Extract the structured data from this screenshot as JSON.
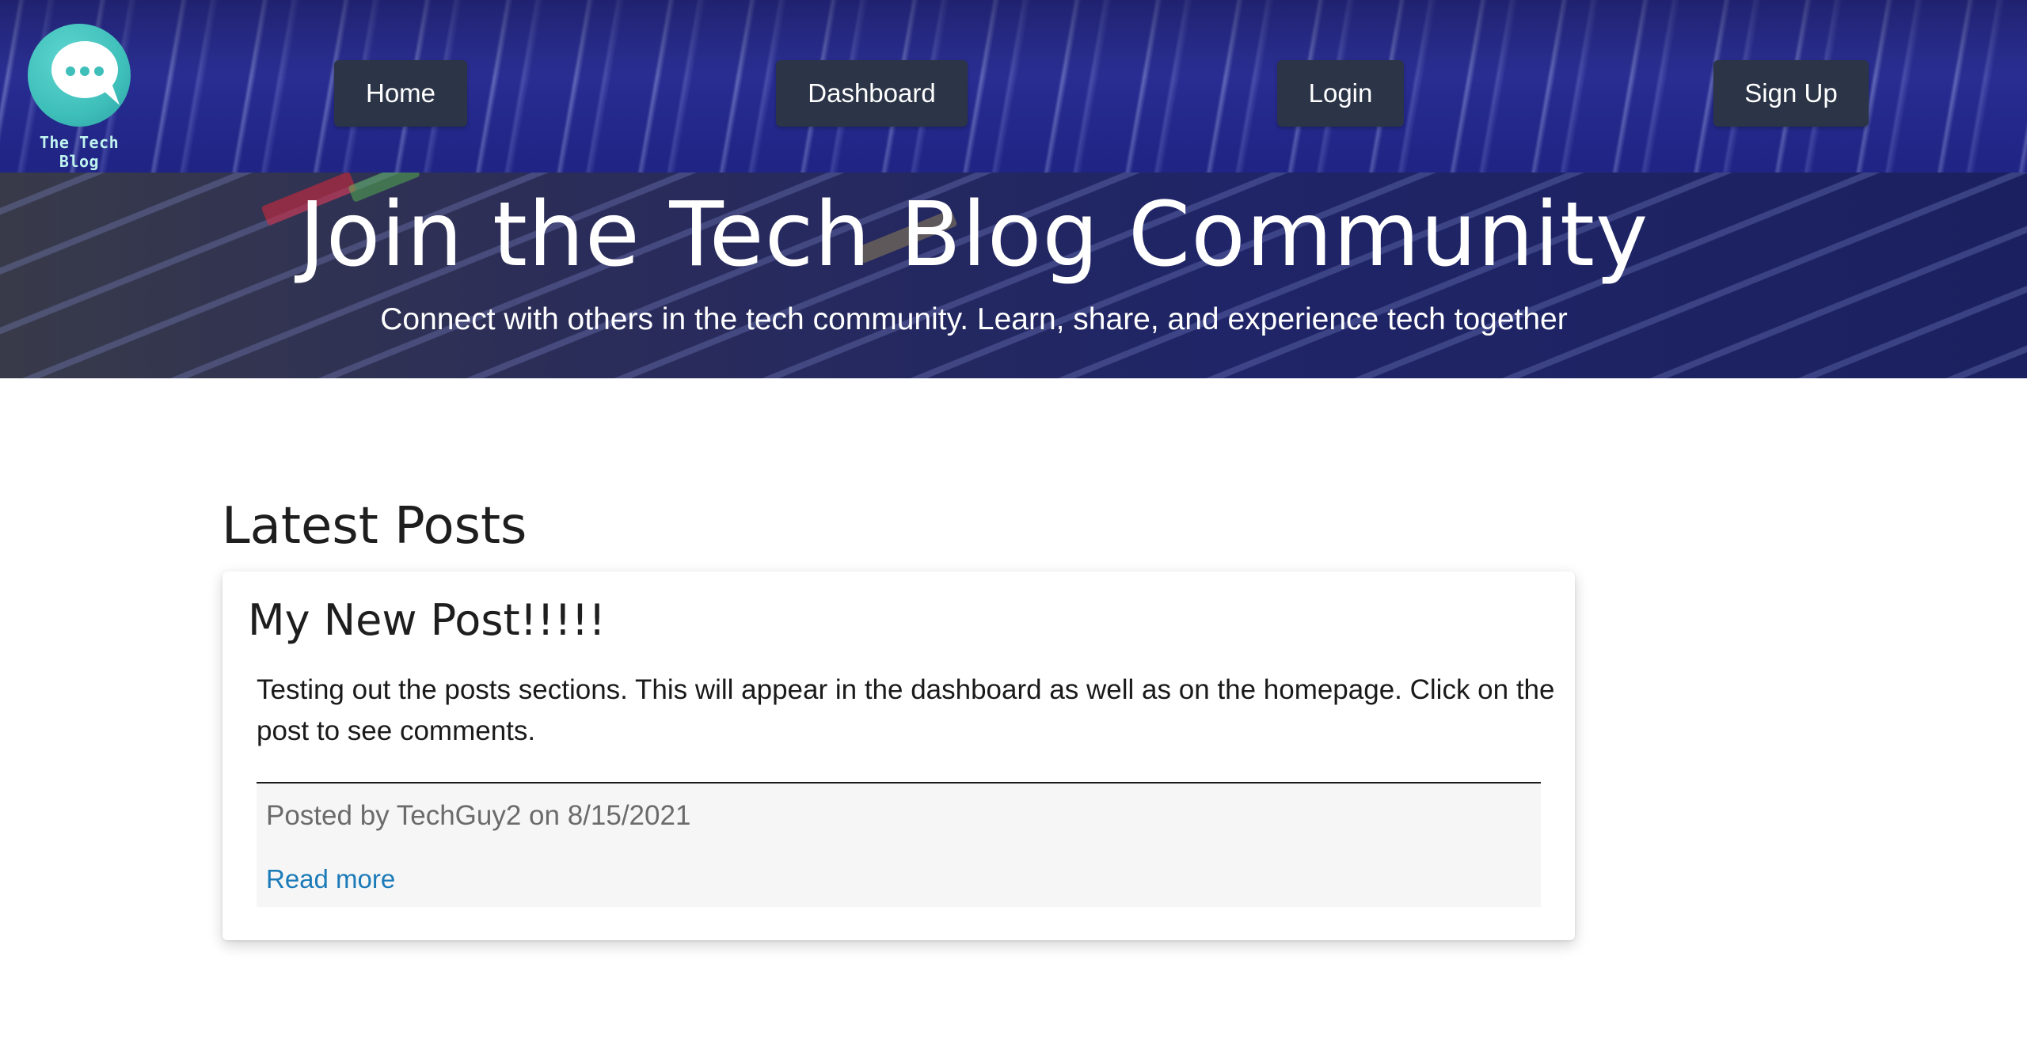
{
  "brand": {
    "logo_text": "The Tech Blog",
    "logo_icon": "chat-bubble-icon",
    "colors": {
      "logo_teal": "#3fbfba",
      "nav_button_bg": "#2c3548",
      "link": "#1b7bb8"
    }
  },
  "nav": {
    "items": [
      {
        "label": "Home"
      },
      {
        "label": "Dashboard"
      },
      {
        "label": "Login"
      },
      {
        "label": "Sign Up"
      }
    ]
  },
  "hero": {
    "title": "Join the Tech Blog Community",
    "subtitle": "Connect with others in the tech community. Learn, share, and experience tech together"
  },
  "main": {
    "section_title": "Latest Posts",
    "posts": [
      {
        "title": "My New Post!!!!!",
        "body": "Testing out the posts sections. This will appear in the dashboard as well as on the homepage. Click on the post to see comments.",
        "meta": "Posted by TechGuy2 on 8/15/2021",
        "read_more": "Read more"
      }
    ]
  }
}
